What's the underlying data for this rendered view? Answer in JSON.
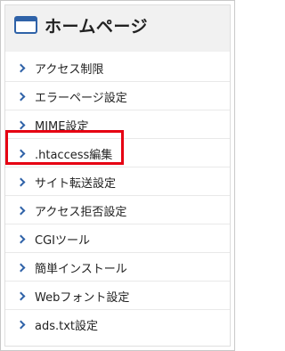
{
  "sidebar": {
    "title": "ホームページ",
    "items": [
      {
        "label": "アクセス制限"
      },
      {
        "label": "エラーページ設定"
      },
      {
        "label": "MIME設定"
      },
      {
        "label": ".htaccess編集"
      },
      {
        "label": "サイト転送設定"
      },
      {
        "label": "アクセス拒否設定"
      },
      {
        "label": "CGIツール"
      },
      {
        "label": "簡単インストール"
      },
      {
        "label": "Webフォント設定"
      },
      {
        "label": "ads.txt設定"
      }
    ]
  },
  "colors": {
    "accent": "#2f62a8",
    "highlight": "#e60012",
    "panel_bg": "#f1f1f1"
  },
  "icons": {
    "header": "window-icon",
    "item": "chevron-right-icon"
  }
}
